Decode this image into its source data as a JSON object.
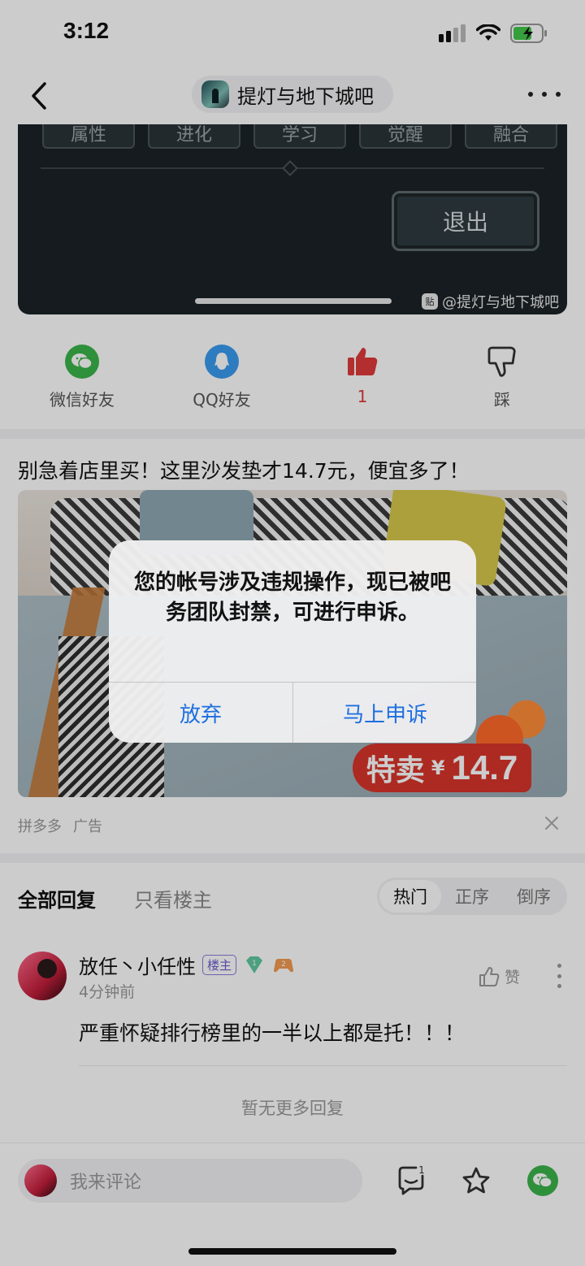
{
  "status_bar": {
    "time": "3:12"
  },
  "nav": {
    "forum_name": "提灯与地下城吧"
  },
  "post_image": {
    "tabs": [
      "属性",
      "进化",
      "学习",
      "觉醒",
      "融合"
    ],
    "exit_label": "退出",
    "watermark_icon_text": "贴",
    "watermark": "@提灯与地下城吧"
  },
  "share": {
    "wechat_label": "微信好友",
    "qq_label": "QQ好友",
    "like_count": "1",
    "dislike_label": "踩",
    "wechat_color": "#3bb44a",
    "qq_color": "#3a9bf0",
    "like_color": "#e03a3a"
  },
  "ad": {
    "title": "别急着店里买！这里沙发垫才14.7元，便宜多了！",
    "price_label": "特卖",
    "price_currency": "¥",
    "price_value": "14.7",
    "source": "拼多多",
    "ad_tag": "广告"
  },
  "replies": {
    "tab_all": "全部回复",
    "tab_lz": "只看楼主",
    "sort_options": [
      "热门",
      "正序",
      "倒序"
    ],
    "sort_selected": "热门",
    "comment": {
      "username": "放任丶小任性",
      "badge_lz": "楼主",
      "level": "1",
      "game_level": "2",
      "time": "4分钟前",
      "like_label": "赞",
      "text": "严重怀疑排行榜里的一半以上都是托！！！"
    },
    "no_more": "暂无更多回复"
  },
  "bottom_bar": {
    "comment_placeholder": "我来评论",
    "comment_count_badge": "1"
  },
  "alert": {
    "message": "您的帐号涉及违规操作，现已被吧务团队封禁，可进行申诉。",
    "cancel_label": "放弃",
    "confirm_label": "马上申诉",
    "button_color": "#1e6fe0"
  }
}
